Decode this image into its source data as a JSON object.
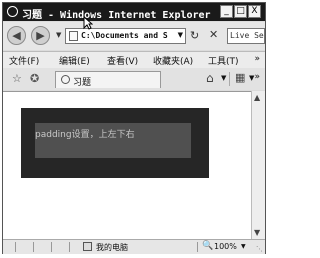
{
  "window": {
    "title": "习题 - Windows Internet Explorer",
    "buttons": {
      "minimize": "_",
      "maximize": "□",
      "close": "X"
    }
  },
  "navigation": {
    "back_icon": "back-arrow-icon",
    "forward_icon": "forward-arrow-icon",
    "address": "C:\\Documents and S",
    "search_placeholder": "Live Se"
  },
  "menu": {
    "items": [
      "文件(F)",
      "编辑(E)",
      "查看(V)",
      "收藏夹(A)",
      "工具(T)"
    ],
    "overflow": "»"
  },
  "tabs": [
    {
      "label": "习题",
      "active": true
    }
  ],
  "toolbar_overflow": "»",
  "content": {
    "box_text": "padding设置，上左下右",
    "outer_color": "#262626",
    "inner_color": "#505050"
  },
  "status": {
    "zone": "我的电脑",
    "zoom": "100%"
  }
}
